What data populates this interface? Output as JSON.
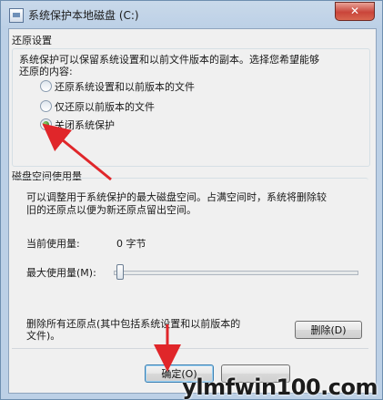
{
  "window": {
    "title": "系统保护本地磁盘 (C:)",
    "close_label": "✕"
  },
  "restore_settings": {
    "group_title": "还原设置",
    "description_line1": "系统保护可以保留系统设置和以前文件版本的副本。选择您希望能够",
    "description_line2": "还原的内容:",
    "options": [
      {
        "label": "还原系统设置和以前版本的文件",
        "checked": false
      },
      {
        "label": "仅还原以前版本的文件",
        "checked": false
      },
      {
        "label": "关闭系统保护",
        "checked": true
      }
    ]
  },
  "disk_usage": {
    "group_title": "磁盘空间使用量",
    "description_line1": "可以调整用于系统保护的最大磁盘空间。占满空间时，系统将删除较",
    "description_line2": "旧的还原点以便为新还原点留出空间。",
    "current_usage_label": "当前使用量:",
    "current_usage_value": "0 字节",
    "max_usage_label": "最大使用量(M):",
    "max_usage_level": 0
  },
  "delete_section": {
    "text_line1": "删除所有还原点(其中包括系统设置和以前版本的",
    "text_line2": "文件)。",
    "delete_button": "删除(D)"
  },
  "buttons": {
    "ok": "确定(O)"
  },
  "watermark": "ylmfwin100.com",
  "colors": {
    "annotation_arrow": "#e0262a"
  }
}
